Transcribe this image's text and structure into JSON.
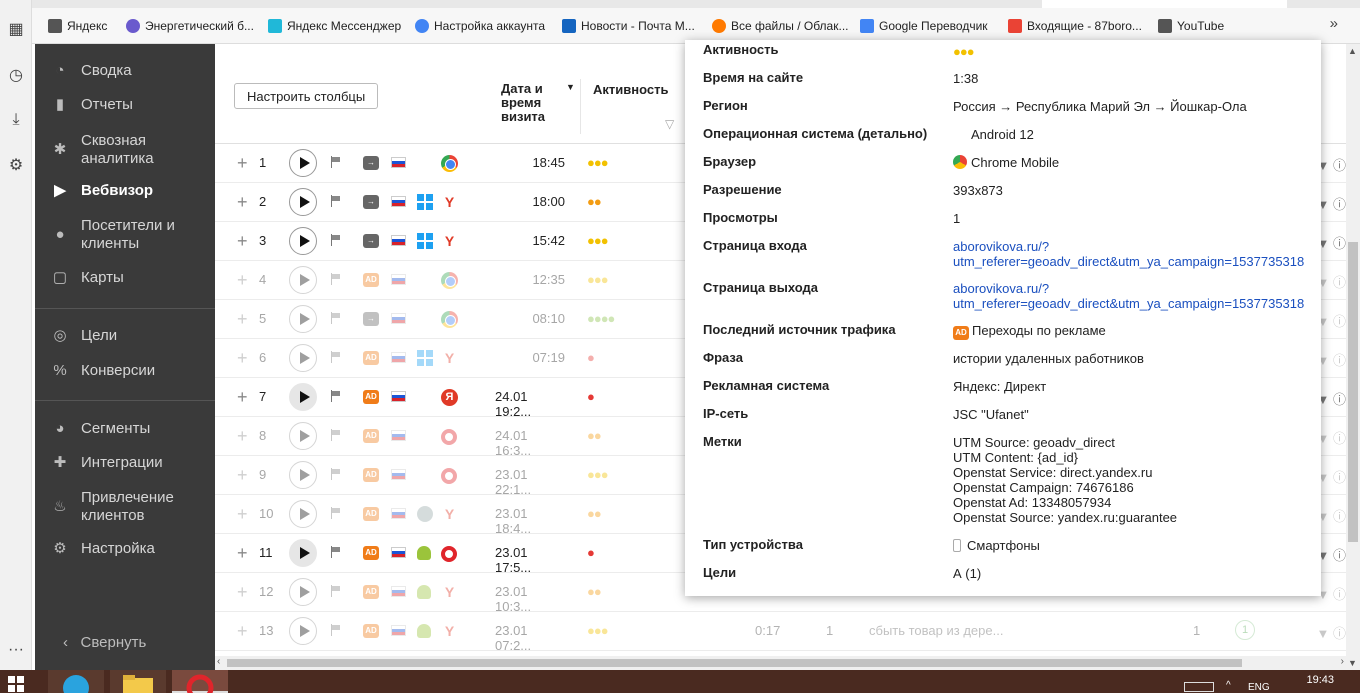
{
  "bookmarks": [
    {
      "label": "Яндекс",
      "icon": "page-icon",
      "color": "#555555"
    },
    {
      "label": "Энергетический б...",
      "icon": "globe-icon",
      "color": "#6a5acd"
    },
    {
      "label": "Яндекс Мессенджер",
      "icon": "messenger-icon",
      "color": "#20b8d8"
    },
    {
      "label": "Настройка аккаунта",
      "icon": "google-account-icon",
      "color": "#4285f4"
    },
    {
      "label": "Новости - Почта М...",
      "icon": "mail-icon",
      "color": "#1565c0"
    },
    {
      "label": "Все файлы / Облак...",
      "icon": "cloud-icon",
      "color": "#ff7a00"
    },
    {
      "label": "Google Переводчик",
      "icon": "translate-icon",
      "color": "#4285f4"
    },
    {
      "label": "Входящие - 87boro...",
      "icon": "google-g-icon",
      "color": "#ea4335"
    },
    {
      "label": "YouTube",
      "icon": "page-icon",
      "color": "#555555"
    }
  ],
  "bookmarks_more": "»",
  "sidebar": {
    "items": [
      {
        "label": "Сводка",
        "icon": "dashboard-icon"
      },
      {
        "label": "Отчеты",
        "icon": "bar-chart-icon"
      },
      {
        "label": "Сквозная аналитика",
        "icon": "analytics-icon"
      },
      {
        "label": "Вебвизор",
        "icon": "play-icon",
        "active": true
      },
      {
        "label": "Посетители и клиенты",
        "icon": "person-icon"
      },
      {
        "label": "Карты",
        "icon": "map-icon"
      },
      {
        "label": "Цели",
        "icon": "target-icon"
      },
      {
        "label": "Конверсии",
        "icon": "percent-icon"
      },
      {
        "label": "Сегменты",
        "icon": "pie-icon"
      },
      {
        "label": "Интеграции",
        "icon": "puzzle-icon"
      },
      {
        "label": "Привлечение клиентов",
        "icon": "flame-icon"
      },
      {
        "label": "Настройка",
        "icon": "gear-icon"
      }
    ],
    "collapse_label": "Свернуть"
  },
  "table": {
    "configure_button": "Настроить столбцы",
    "col_date": "Дата и время визита",
    "col_activity": "Активность",
    "rows": [
      {
        "n": "1",
        "source": "direct",
        "os": "",
        "browser": "chrome",
        "time": "18:45",
        "activity": "●●●",
        "act_color": "#f2c100",
        "faded": false
      },
      {
        "n": "2",
        "source": "direct",
        "os": "win",
        "browser": "ybrowser",
        "time": "18:00",
        "activity": "●●",
        "act_color": "#f39c12",
        "faded": false
      },
      {
        "n": "3",
        "source": "direct",
        "os": "win",
        "browser": "ybrowser",
        "time": "15:42",
        "activity": "●●●",
        "act_color": "#f2c100",
        "faded": false
      },
      {
        "n": "4",
        "source": "ad",
        "os": "",
        "browser": "chrome",
        "time": "12:35",
        "activity": "●●●",
        "act_color": "#f2c100",
        "faded": true
      },
      {
        "n": "5",
        "source": "direct",
        "os": "",
        "browser": "chrome",
        "time": "08:10",
        "activity": "●●●●",
        "act_color": "#8bc34a",
        "faded": true
      },
      {
        "n": "6",
        "source": "ad",
        "os": "win",
        "browser": "ybrowser",
        "time": "07:19",
        "activity": "●",
        "act_color": "#e53935",
        "faded": true
      },
      {
        "n": "7",
        "source": "ad",
        "os": "",
        "browser": "yandex-red",
        "time": "24.01 19:2...",
        "activity": "●",
        "act_color": "#e53935",
        "faded": false,
        "shaded": true
      },
      {
        "n": "8",
        "source": "ad",
        "os": "",
        "browser": "opera",
        "time": "24.01 16:3...",
        "activity": "●●",
        "act_color": "#f39c12",
        "faded": true
      },
      {
        "n": "9",
        "source": "ad",
        "os": "",
        "browser": "opera",
        "time": "23.01 22:1...",
        "activity": "●●●",
        "act_color": "#f2c100",
        "faded": true
      },
      {
        "n": "10",
        "source": "ad",
        "os": "other",
        "browser": "ybrowser",
        "time": "23.01 18:4...",
        "activity": "●●",
        "act_color": "#f39c12",
        "faded": true
      },
      {
        "n": "11",
        "source": "ad",
        "os": "android",
        "browser": "opera",
        "time": "23.01 17:5...",
        "activity": "●",
        "act_color": "#e53935",
        "faded": false,
        "shaded": true
      },
      {
        "n": "12",
        "source": "ad",
        "os": "android",
        "browser": "ybrowser",
        "time": "23.01 10:3...",
        "activity": "●●",
        "act_color": "#f39c12",
        "faded": true
      },
      {
        "n": "13",
        "source": "ad",
        "os": "android",
        "browser": "ybrowser",
        "time": "23.01 07:2...",
        "activity": "●●●",
        "act_color": "#f2c100",
        "faded": true
      }
    ],
    "row13_extra": {
      "duration": "0:17",
      "views": "1",
      "phrase": "сбыть товар из дере...",
      "count": "1",
      "goal": "1"
    }
  },
  "card": {
    "activity_label": "Активность",
    "activity_value": "●●●",
    "fields": [
      {
        "key": "Время на сайте",
        "value": "1:38"
      },
      {
        "key": "Регион",
        "value": "Россия → Республика Марий Эл → Йошкар-Ола"
      },
      {
        "key": "Операционная система (детально)",
        "value": "Android 12"
      },
      {
        "key": "Браузер",
        "value": "Chrome Mobile"
      },
      {
        "key": "Разрешение",
        "value": "393x873"
      },
      {
        "key": "Просмотры",
        "value": "1"
      },
      {
        "key": "Страница входа",
        "value": "aborovikova.ru/?\nutm_referer=geoadv_direct&utm_ya_campaign=1537735318"
      },
      {
        "key": "Страница выхода",
        "value": "aborovikova.ru/?\nutm_referer=geoadv_direct&utm_ya_campaign=1537735318"
      },
      {
        "key": "Последний источник трафика",
        "value": "Переходы по рекламе"
      },
      {
        "key": "Фраза",
        "value": "истории удаленных работников"
      },
      {
        "key": "Рекламная система",
        "value": "Яндекс: Директ"
      },
      {
        "key": "IP-сеть",
        "value": "JSC \"Ufanet\""
      },
      {
        "key": "Метки",
        "value": "UTM Source: geoadv_direct\nUTM Content: {ad_id}\nOpenstat Service: direct.yandex.ru\nOpenstat Campaign: 74676186\nOpenstat Ad: 13348057934\nOpenstat Source: yandex.ru:guarantee"
      },
      {
        "key": "Тип устройства",
        "value": "Смартфоны"
      },
      {
        "key": "Цели",
        "value": "А (1)"
      }
    ],
    "ad_badge": "AD"
  },
  "taskbar": {
    "lang": "ENG",
    "clock": "19:43"
  }
}
